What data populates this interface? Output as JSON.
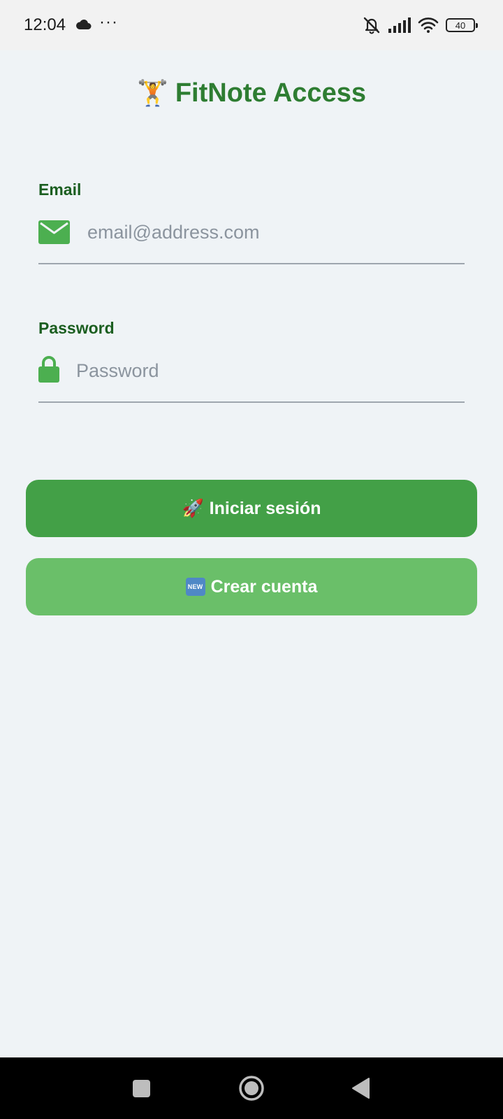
{
  "status_bar": {
    "time": "12:04",
    "dots": "···",
    "battery": "40",
    "icons": [
      "cloud-icon",
      "mute-icon",
      "signal-icon",
      "wifi-icon",
      "battery-icon"
    ]
  },
  "header": {
    "emoji": "🏋️",
    "title": "FitNote Access"
  },
  "form": {
    "email": {
      "label": "Email",
      "placeholder": "email@address.com",
      "value": "",
      "icon": "mail-icon"
    },
    "password": {
      "label": "Password",
      "placeholder": "Password",
      "value": "",
      "icon": "lock-icon"
    }
  },
  "buttons": {
    "login": {
      "emoji": "🚀",
      "label": "Iniciar sesión"
    },
    "register": {
      "badge": "NEW",
      "label": "Crear cuenta"
    }
  },
  "navigation": {
    "icons": [
      "recents-icon",
      "home-icon",
      "back-icon"
    ]
  },
  "colors": {
    "background": "#eff3f6",
    "title": "#2e7d32",
    "label": "#1b5e20",
    "icon_green": "#4caf50",
    "primary_button": "#43a047",
    "secondary_button": "#6abf69",
    "divider": "#9ea6ae"
  }
}
